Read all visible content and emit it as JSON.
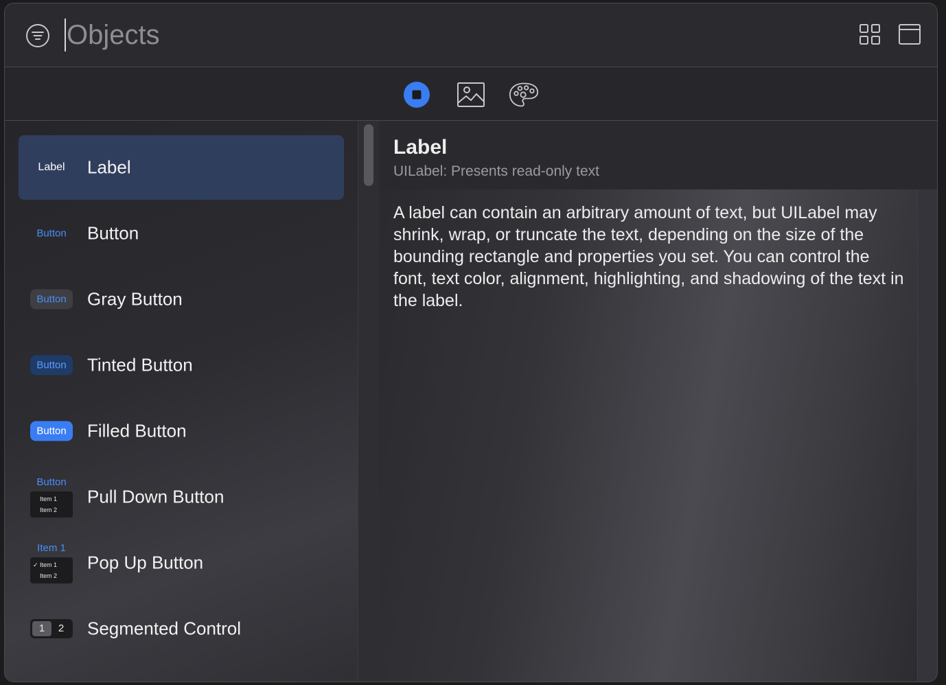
{
  "search": {
    "placeholder": "Objects",
    "value": ""
  },
  "tabs": [
    {
      "name": "objects",
      "icon": "objects-icon",
      "active": true
    },
    {
      "name": "media",
      "icon": "image-icon",
      "active": false
    },
    {
      "name": "colors",
      "icon": "palette-icon",
      "active": false
    }
  ],
  "list": {
    "items": [
      {
        "title": "Label",
        "thumb": "Label"
      },
      {
        "title": "Button",
        "thumb": "Button"
      },
      {
        "title": "Gray Button",
        "thumb": "Button"
      },
      {
        "title": "Tinted Button",
        "thumb": "Button"
      },
      {
        "title": "Filled Button",
        "thumb": "Button"
      },
      {
        "title": "Pull Down Button",
        "thumb": "Button",
        "menu": [
          "Item 1",
          "Item 2"
        ]
      },
      {
        "title": "Pop Up Button",
        "thumb": "Item 1",
        "menu": [
          "Item 1",
          "Item 2"
        ]
      },
      {
        "title": "Segmented Control",
        "segments": [
          "1",
          "2"
        ]
      }
    ]
  },
  "detail": {
    "title": "Label",
    "subtitle": "UILabel: Presents read-only text",
    "body": "A label can contain an arbitrary amount of text, but UILabel may shrink, wrap, or truncate the text, depending on the size of the bounding rectangle and properties you set. You can control the font, text color, alignment, highlighting, and shadowing of the text in the label."
  },
  "colors": {
    "accent": "#3a7df2",
    "selected_row": "#303e5e",
    "link_blue": "#4b8ef7"
  }
}
